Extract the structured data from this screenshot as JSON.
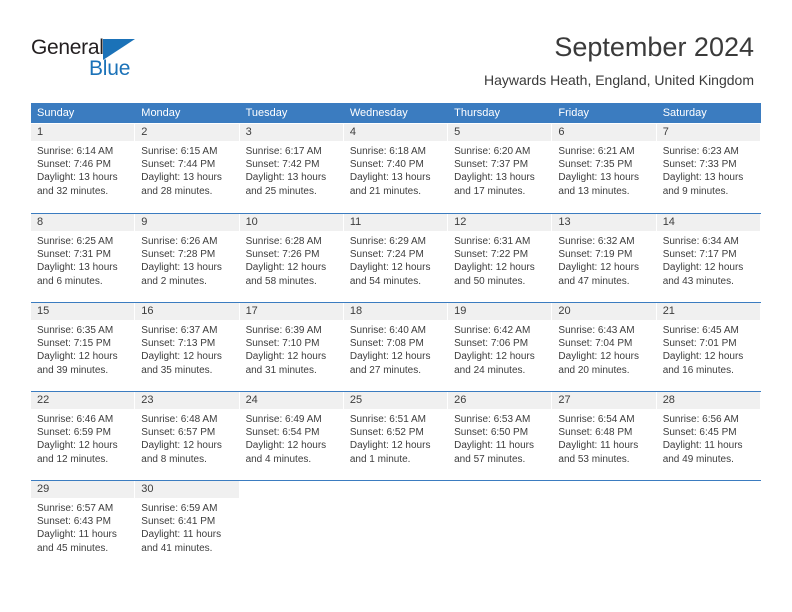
{
  "brand": {
    "name_part1": "General",
    "name_part2": "Blue",
    "color_blue": "#1b72b8",
    "color_dark": "#231f20",
    "triangle_icon": "triangle-icon"
  },
  "header": {
    "title": "September 2024",
    "subtitle": "Haywards Heath, England, United Kingdom"
  },
  "theme": {
    "header_row_bg": "#3b7cc0",
    "daynum_band_bg": "#f0f0f0",
    "text_color": "#3d3d3d",
    "page_bg": "#ffffff"
  },
  "calendar": {
    "month": "September",
    "year": "2024",
    "location": "Haywards Heath, England, United Kingdom",
    "day_headers": [
      "Sunday",
      "Monday",
      "Tuesday",
      "Wednesday",
      "Thursday",
      "Friday",
      "Saturday"
    ],
    "weeks": [
      [
        {
          "day": "1",
          "sunrise": "Sunrise: 6:14 AM",
          "sunset": "Sunset: 7:46 PM",
          "daylight_1": "Daylight: 13 hours",
          "daylight_2": "and 32 minutes."
        },
        {
          "day": "2",
          "sunrise": "Sunrise: 6:15 AM",
          "sunset": "Sunset: 7:44 PM",
          "daylight_1": "Daylight: 13 hours",
          "daylight_2": "and 28 minutes."
        },
        {
          "day": "3",
          "sunrise": "Sunrise: 6:17 AM",
          "sunset": "Sunset: 7:42 PM",
          "daylight_1": "Daylight: 13 hours",
          "daylight_2": "and 25 minutes."
        },
        {
          "day": "4",
          "sunrise": "Sunrise: 6:18 AM",
          "sunset": "Sunset: 7:40 PM",
          "daylight_1": "Daylight: 13 hours",
          "daylight_2": "and 21 minutes."
        },
        {
          "day": "5",
          "sunrise": "Sunrise: 6:20 AM",
          "sunset": "Sunset: 7:37 PM",
          "daylight_1": "Daylight: 13 hours",
          "daylight_2": "and 17 minutes."
        },
        {
          "day": "6",
          "sunrise": "Sunrise: 6:21 AM",
          "sunset": "Sunset: 7:35 PM",
          "daylight_1": "Daylight: 13 hours",
          "daylight_2": "and 13 minutes."
        },
        {
          "day": "7",
          "sunrise": "Sunrise: 6:23 AM",
          "sunset": "Sunset: 7:33 PM",
          "daylight_1": "Daylight: 13 hours",
          "daylight_2": "and 9 minutes."
        }
      ],
      [
        {
          "day": "8",
          "sunrise": "Sunrise: 6:25 AM",
          "sunset": "Sunset: 7:31 PM",
          "daylight_1": "Daylight: 13 hours",
          "daylight_2": "and 6 minutes."
        },
        {
          "day": "9",
          "sunrise": "Sunrise: 6:26 AM",
          "sunset": "Sunset: 7:28 PM",
          "daylight_1": "Daylight: 13 hours",
          "daylight_2": "and 2 minutes."
        },
        {
          "day": "10",
          "sunrise": "Sunrise: 6:28 AM",
          "sunset": "Sunset: 7:26 PM",
          "daylight_1": "Daylight: 12 hours",
          "daylight_2": "and 58 minutes."
        },
        {
          "day": "11",
          "sunrise": "Sunrise: 6:29 AM",
          "sunset": "Sunset: 7:24 PM",
          "daylight_1": "Daylight: 12 hours",
          "daylight_2": "and 54 minutes."
        },
        {
          "day": "12",
          "sunrise": "Sunrise: 6:31 AM",
          "sunset": "Sunset: 7:22 PM",
          "daylight_1": "Daylight: 12 hours",
          "daylight_2": "and 50 minutes."
        },
        {
          "day": "13",
          "sunrise": "Sunrise: 6:32 AM",
          "sunset": "Sunset: 7:19 PM",
          "daylight_1": "Daylight: 12 hours",
          "daylight_2": "and 47 minutes."
        },
        {
          "day": "14",
          "sunrise": "Sunrise: 6:34 AM",
          "sunset": "Sunset: 7:17 PM",
          "daylight_1": "Daylight: 12 hours",
          "daylight_2": "and 43 minutes."
        }
      ],
      [
        {
          "day": "15",
          "sunrise": "Sunrise: 6:35 AM",
          "sunset": "Sunset: 7:15 PM",
          "daylight_1": "Daylight: 12 hours",
          "daylight_2": "and 39 minutes."
        },
        {
          "day": "16",
          "sunrise": "Sunrise: 6:37 AM",
          "sunset": "Sunset: 7:13 PM",
          "daylight_1": "Daylight: 12 hours",
          "daylight_2": "and 35 minutes."
        },
        {
          "day": "17",
          "sunrise": "Sunrise: 6:39 AM",
          "sunset": "Sunset: 7:10 PM",
          "daylight_1": "Daylight: 12 hours",
          "daylight_2": "and 31 minutes."
        },
        {
          "day": "18",
          "sunrise": "Sunrise: 6:40 AM",
          "sunset": "Sunset: 7:08 PM",
          "daylight_1": "Daylight: 12 hours",
          "daylight_2": "and 27 minutes."
        },
        {
          "day": "19",
          "sunrise": "Sunrise: 6:42 AM",
          "sunset": "Sunset: 7:06 PM",
          "daylight_1": "Daylight: 12 hours",
          "daylight_2": "and 24 minutes."
        },
        {
          "day": "20",
          "sunrise": "Sunrise: 6:43 AM",
          "sunset": "Sunset: 7:04 PM",
          "daylight_1": "Daylight: 12 hours",
          "daylight_2": "and 20 minutes."
        },
        {
          "day": "21",
          "sunrise": "Sunrise: 6:45 AM",
          "sunset": "Sunset: 7:01 PM",
          "daylight_1": "Daylight: 12 hours",
          "daylight_2": "and 16 minutes."
        }
      ],
      [
        {
          "day": "22",
          "sunrise": "Sunrise: 6:46 AM",
          "sunset": "Sunset: 6:59 PM",
          "daylight_1": "Daylight: 12 hours",
          "daylight_2": "and 12 minutes."
        },
        {
          "day": "23",
          "sunrise": "Sunrise: 6:48 AM",
          "sunset": "Sunset: 6:57 PM",
          "daylight_1": "Daylight: 12 hours",
          "daylight_2": "and 8 minutes."
        },
        {
          "day": "24",
          "sunrise": "Sunrise: 6:49 AM",
          "sunset": "Sunset: 6:54 PM",
          "daylight_1": "Daylight: 12 hours",
          "daylight_2": "and 4 minutes."
        },
        {
          "day": "25",
          "sunrise": "Sunrise: 6:51 AM",
          "sunset": "Sunset: 6:52 PM",
          "daylight_1": "Daylight: 12 hours",
          "daylight_2": "and 1 minute."
        },
        {
          "day": "26",
          "sunrise": "Sunrise: 6:53 AM",
          "sunset": "Sunset: 6:50 PM",
          "daylight_1": "Daylight: 11 hours",
          "daylight_2": "and 57 minutes."
        },
        {
          "day": "27",
          "sunrise": "Sunrise: 6:54 AM",
          "sunset": "Sunset: 6:48 PM",
          "daylight_1": "Daylight: 11 hours",
          "daylight_2": "and 53 minutes."
        },
        {
          "day": "28",
          "sunrise": "Sunrise: 6:56 AM",
          "sunset": "Sunset: 6:45 PM",
          "daylight_1": "Daylight: 11 hours",
          "daylight_2": "and 49 minutes."
        }
      ],
      [
        {
          "day": "29",
          "sunrise": "Sunrise: 6:57 AM",
          "sunset": "Sunset: 6:43 PM",
          "daylight_1": "Daylight: 11 hours",
          "daylight_2": "and 45 minutes."
        },
        {
          "day": "30",
          "sunrise": "Sunrise: 6:59 AM",
          "sunset": "Sunset: 6:41 PM",
          "daylight_1": "Daylight: 11 hours",
          "daylight_2": "and 41 minutes."
        },
        {
          "day": "",
          "sunrise": "",
          "sunset": "",
          "daylight_1": "",
          "daylight_2": ""
        },
        {
          "day": "",
          "sunrise": "",
          "sunset": "",
          "daylight_1": "",
          "daylight_2": ""
        },
        {
          "day": "",
          "sunrise": "",
          "sunset": "",
          "daylight_1": "",
          "daylight_2": ""
        },
        {
          "day": "",
          "sunrise": "",
          "sunset": "",
          "daylight_1": "",
          "daylight_2": ""
        },
        {
          "day": "",
          "sunrise": "",
          "sunset": "",
          "daylight_1": "",
          "daylight_2": ""
        }
      ]
    ]
  }
}
